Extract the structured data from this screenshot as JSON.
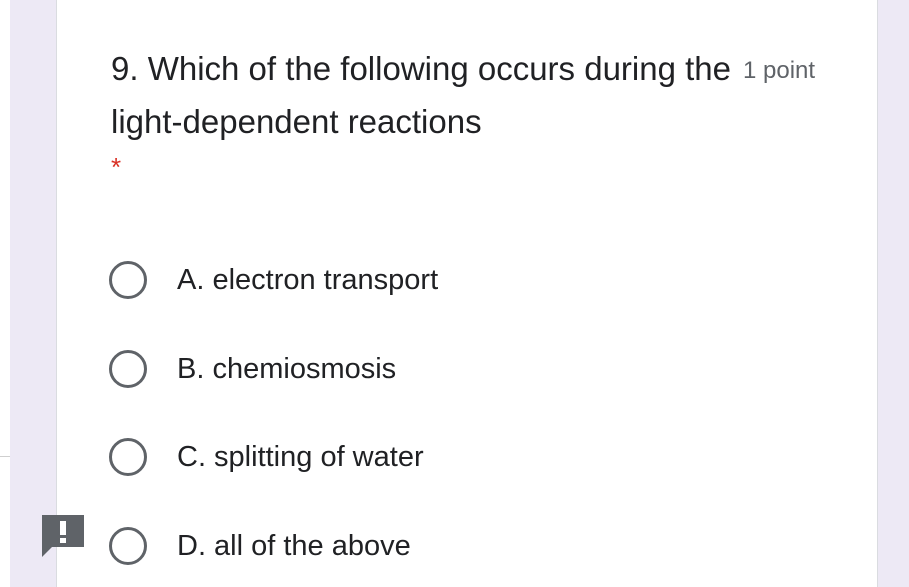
{
  "question": {
    "title": "9. Which of the following occurs during the light-dependent reactions",
    "required_marker": "*",
    "points": "1 point"
  },
  "options": [
    {
      "label": "A. electron transport",
      "selected": false
    },
    {
      "label": "B. chemiosmosis",
      "selected": false
    },
    {
      "label": "C. splitting of water",
      "selected": false
    },
    {
      "label": "D. all of the above",
      "selected": false
    }
  ],
  "icons": {
    "radio": "radio-unchecked-icon",
    "report": "report-feedback-icon"
  },
  "colors": {
    "page_background": "#ede9f5",
    "card_background": "#ffffff",
    "text": "#202124",
    "secondary_text": "#5f6368",
    "required": "#d93025",
    "report_icon": "#5f6368"
  }
}
